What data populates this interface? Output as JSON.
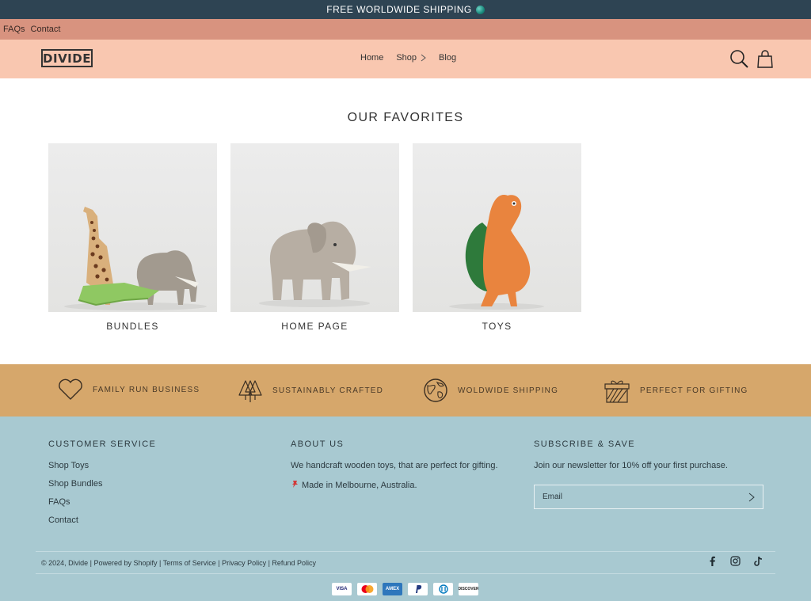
{
  "announcement": {
    "text": "FREE WORLDWIDE SHIPPING",
    "icon": "globe-icon"
  },
  "utility_nav": {
    "items": [
      "FAQs",
      "Contact"
    ]
  },
  "header": {
    "logo": "DIVIDE",
    "nav": [
      {
        "label": "Home"
      },
      {
        "label": "Shop",
        "has_dropdown": true
      },
      {
        "label": "Blog"
      }
    ],
    "icons": [
      "search-icon",
      "cart-icon"
    ]
  },
  "favorites": {
    "title": "OUR FAVORITES",
    "collections": [
      {
        "label": "BUNDLES"
      },
      {
        "label": "HOME PAGE"
      },
      {
        "label": "TOYS"
      }
    ]
  },
  "values": [
    {
      "icon": "heart-icon",
      "label": "FAMILY RUN BUSINESS"
    },
    {
      "icon": "trees-icon",
      "label": "SUSTAINABLY CRAFTED"
    },
    {
      "icon": "globe-icon",
      "label": "WOLDWIDE SHIPPING"
    },
    {
      "icon": "gift-icon",
      "label": "PERFECT FOR GIFTING"
    }
  ],
  "footer": {
    "customer_service": {
      "title": "CUSTOMER SERVICE",
      "links": [
        "Shop Toys",
        "Shop Bundles",
        "FAQs",
        "Contact"
      ]
    },
    "about": {
      "title": "ABOUT US",
      "text": "We handcraft wooden toys, that are perfect for gifting.",
      "location": "Made in Melbourne, Australia."
    },
    "subscribe": {
      "title": "SUBSCRIBE & SAVE",
      "text": "Join our newsletter for 10% off your first purchase.",
      "email_placeholder": "Email"
    },
    "copyright": "© 2024, Divide | Powered by Shopify | Terms of Service | Privacy Policy | Refund Policy",
    "social": [
      "facebook-icon",
      "instagram-icon",
      "tiktok-icon"
    ],
    "payments": [
      "VISA",
      "Mastercard",
      "AMEX",
      "PayPal",
      "Diners",
      "DISCOVER"
    ]
  },
  "colors": {
    "announcement_bg": "#2e4453",
    "utility_bg": "#d8937f",
    "header_bg": "#f9c7b0",
    "values_bg": "#d6a76b",
    "footer_bg": "#a8c9d1"
  }
}
